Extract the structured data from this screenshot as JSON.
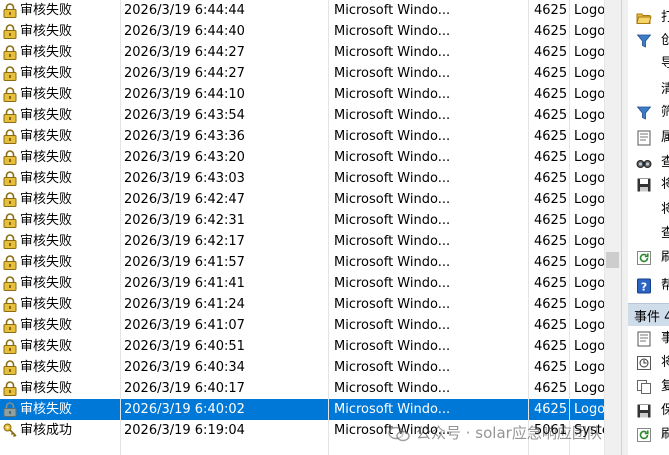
{
  "events": [
    {
      "keyword": "审核失败",
      "datetime": "2026/3/19 6:44:44",
      "source": "Microsoft Windo...",
      "event_id": "4625",
      "category": "Logo",
      "icon": "lock-icon"
    },
    {
      "keyword": "审核失败",
      "datetime": "2026/3/19 6:44:40",
      "source": "Microsoft Windo...",
      "event_id": "4625",
      "category": "Logo",
      "icon": "lock-icon"
    },
    {
      "keyword": "审核失败",
      "datetime": "2026/3/19 6:44:27",
      "source": "Microsoft Windo...",
      "event_id": "4625",
      "category": "Logo",
      "icon": "lock-icon"
    },
    {
      "keyword": "审核失败",
      "datetime": "2026/3/19 6:44:27",
      "source": "Microsoft Windo...",
      "event_id": "4625",
      "category": "Logo",
      "icon": "lock-icon"
    },
    {
      "keyword": "审核失败",
      "datetime": "2026/3/19 6:44:10",
      "source": "Microsoft Windo...",
      "event_id": "4625",
      "category": "Logo",
      "icon": "lock-icon"
    },
    {
      "keyword": "审核失败",
      "datetime": "2026/3/19 6:43:54",
      "source": "Microsoft Windo...",
      "event_id": "4625",
      "category": "Logo",
      "icon": "lock-icon"
    },
    {
      "keyword": "审核失败",
      "datetime": "2026/3/19 6:43:36",
      "source": "Microsoft Windo...",
      "event_id": "4625",
      "category": "Logo",
      "icon": "lock-icon"
    },
    {
      "keyword": "审核失败",
      "datetime": "2026/3/19 6:43:20",
      "source": "Microsoft Windo...",
      "event_id": "4625",
      "category": "Logo",
      "icon": "lock-icon"
    },
    {
      "keyword": "审核失败",
      "datetime": "2026/3/19 6:43:03",
      "source": "Microsoft Windo...",
      "event_id": "4625",
      "category": "Logo",
      "icon": "lock-icon"
    },
    {
      "keyword": "审核失败",
      "datetime": "2026/3/19 6:42:47",
      "source": "Microsoft Windo...",
      "event_id": "4625",
      "category": "Logo",
      "icon": "lock-icon"
    },
    {
      "keyword": "审核失败",
      "datetime": "2026/3/19 6:42:31",
      "source": "Microsoft Windo...",
      "event_id": "4625",
      "category": "Logo",
      "icon": "lock-icon"
    },
    {
      "keyword": "审核失败",
      "datetime": "2026/3/19 6:42:17",
      "source": "Microsoft Windo...",
      "event_id": "4625",
      "category": "Logo",
      "icon": "lock-icon"
    },
    {
      "keyword": "审核失败",
      "datetime": "2026/3/19 6:41:57",
      "source": "Microsoft Windo...",
      "event_id": "4625",
      "category": "Logo",
      "icon": "lock-icon"
    },
    {
      "keyword": "审核失败",
      "datetime": "2026/3/19 6:41:41",
      "source": "Microsoft Windo...",
      "event_id": "4625",
      "category": "Logo",
      "icon": "lock-icon"
    },
    {
      "keyword": "审核失败",
      "datetime": "2026/3/19 6:41:24",
      "source": "Microsoft Windo...",
      "event_id": "4625",
      "category": "Logo",
      "icon": "lock-icon"
    },
    {
      "keyword": "审核失败",
      "datetime": "2026/3/19 6:41:07",
      "source": "Microsoft Windo...",
      "event_id": "4625",
      "category": "Logo",
      "icon": "lock-icon"
    },
    {
      "keyword": "审核失败",
      "datetime": "2026/3/19 6:40:51",
      "source": "Microsoft Windo...",
      "event_id": "4625",
      "category": "Logo",
      "icon": "lock-icon"
    },
    {
      "keyword": "审核失败",
      "datetime": "2026/3/19 6:40:34",
      "source": "Microsoft Windo...",
      "event_id": "4625",
      "category": "Logo",
      "icon": "lock-icon"
    },
    {
      "keyword": "审核失败",
      "datetime": "2026/3/19 6:40:17",
      "source": "Microsoft Windo...",
      "event_id": "4625",
      "category": "Logo",
      "icon": "lock-icon"
    },
    {
      "keyword": "审核失败",
      "datetime": "2026/3/19 6:40:02",
      "source": "Microsoft Windo...",
      "event_id": "4625",
      "category": "Logo",
      "icon": "lock-icon",
      "selected": true
    },
    {
      "keyword": "审核成功",
      "datetime": "2026/3/19 6:19:04",
      "source": "Microsoft Windo...",
      "event_id": "5061",
      "category": "Syste",
      "icon": "key-icon"
    }
  ],
  "actions_pane": {
    "items": [
      {
        "label": "打",
        "icon": "open-folder-icon"
      },
      {
        "label": "创",
        "icon": "filter-icon"
      },
      {
        "label": "导",
        "icon": ""
      },
      {
        "label": "清",
        "icon": ""
      },
      {
        "label": "筛",
        "icon": "filter-icon"
      },
      {
        "label": "属",
        "icon": "properties-icon"
      },
      {
        "label": "查",
        "icon": "find-icon"
      },
      {
        "label": "将",
        "icon": "save-icon"
      },
      {
        "label": "将",
        "icon": ""
      },
      {
        "label": "查",
        "icon": ""
      },
      {
        "label": "刷",
        "icon": "refresh-icon"
      },
      {
        "label": "帮",
        "icon": "help-icon"
      }
    ],
    "section_title": "事件 4",
    "section_items": [
      {
        "label": "事",
        "icon": "event-properties-icon"
      },
      {
        "label": "将",
        "icon": "attach-task-icon"
      },
      {
        "label": "复",
        "icon": "copy-icon"
      },
      {
        "label": "保",
        "icon": "save-icon"
      },
      {
        "label": "刷",
        "icon": "refresh-icon"
      }
    ]
  },
  "watermark": {
    "text": "公众号 · solar应急响应团队"
  },
  "colors": {
    "selected_row": "#0078d7",
    "section_header": "#cfdcea"
  }
}
